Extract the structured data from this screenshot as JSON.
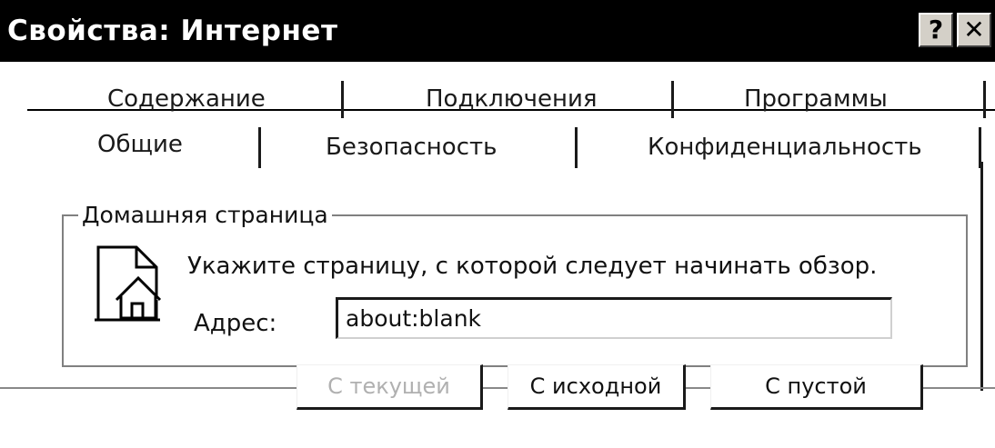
{
  "window": {
    "title": "Свойства: Интернет",
    "help_glyph": "?",
    "close_glyph": "✕"
  },
  "tabs": {
    "back_row": [
      "Содержание",
      "Подключения",
      "Программы"
    ],
    "front_row": [
      "Общие",
      "Безопасность",
      "Конфиденциальность"
    ],
    "active": "Общие"
  },
  "home_page": {
    "group_label": "Домашняя страница",
    "hint": "Укажите страницу, с которой следует начинать обзор.",
    "address_label": "Адрес:",
    "address_value": "about:blank",
    "buttons": {
      "use_current": "С текущей",
      "use_default": "С исходной",
      "use_blank": "С пустой"
    },
    "use_current_enabled": false
  },
  "icons": {
    "home_page": "home-page-icon",
    "help": "help-icon",
    "close": "close-icon"
  },
  "colors": {
    "title_bar": "#000000",
    "window_bg": "#ffffff",
    "disabled_text": "#b0b0b0"
  }
}
